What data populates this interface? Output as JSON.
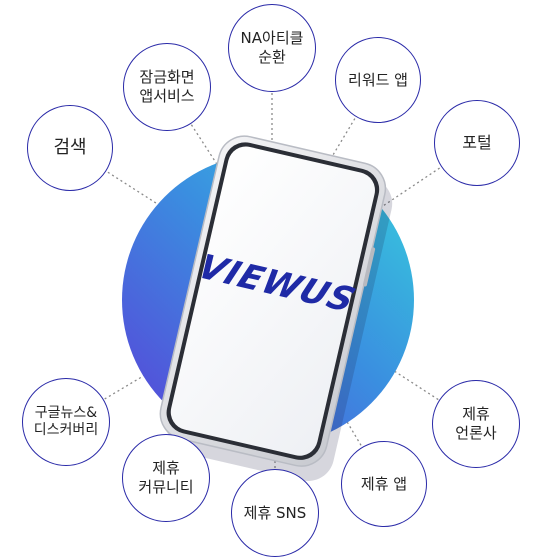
{
  "logo": {
    "text": "VIEWUS"
  },
  "services": [
    {
      "label": "검색"
    },
    {
      "label": "잠금화면\n앱서비스"
    },
    {
      "label": "NA아티클\n순환"
    },
    {
      "label": "리워드 앱"
    },
    {
      "label": "포털"
    },
    {
      "label": "구글뉴스&\n디스커버리"
    },
    {
      "label": "제휴\n커뮤니티"
    },
    {
      "label": "제휴 SNS"
    },
    {
      "label": "제휴 앱"
    },
    {
      "label": "제휴\n언론사"
    }
  ],
  "colors": {
    "node_border": "#2a2aa8",
    "connector": "#8a8a8a",
    "gradient_start": "#4a3fd6",
    "gradient_end": "#38c6dc",
    "logo": "#1f2aa6"
  }
}
